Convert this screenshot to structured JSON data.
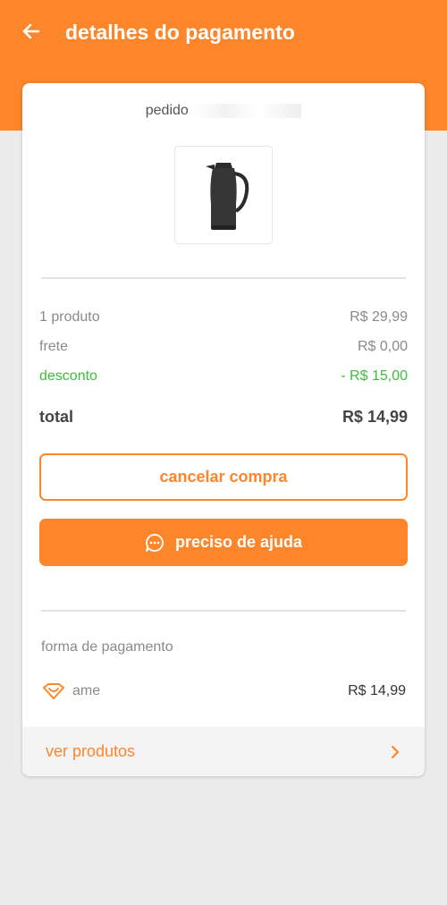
{
  "header": {
    "title": "detalhes do pagamento",
    "back_icon": "arrow-left-icon"
  },
  "order": {
    "label": "pedido"
  },
  "summary": {
    "products_label": "1 produto",
    "products_value": "R$ 29,99",
    "shipping_label": "frete",
    "shipping_value": "R$ 0,00",
    "discount_label": "desconto",
    "discount_value": "- R$ 15,00",
    "total_label": "total",
    "total_value": "R$ 14,99"
  },
  "actions": {
    "cancel_label": "cancelar compra",
    "help_label": "preciso de ajuda"
  },
  "payment": {
    "section_label": "forma de pagamento",
    "method_name": "ame",
    "method_amount": "R$ 14,99"
  },
  "footer": {
    "link_label": "ver produtos"
  },
  "colors": {
    "accent": "#fd862b",
    "discount": "#3bbd3b",
    "background": "#ececec"
  }
}
